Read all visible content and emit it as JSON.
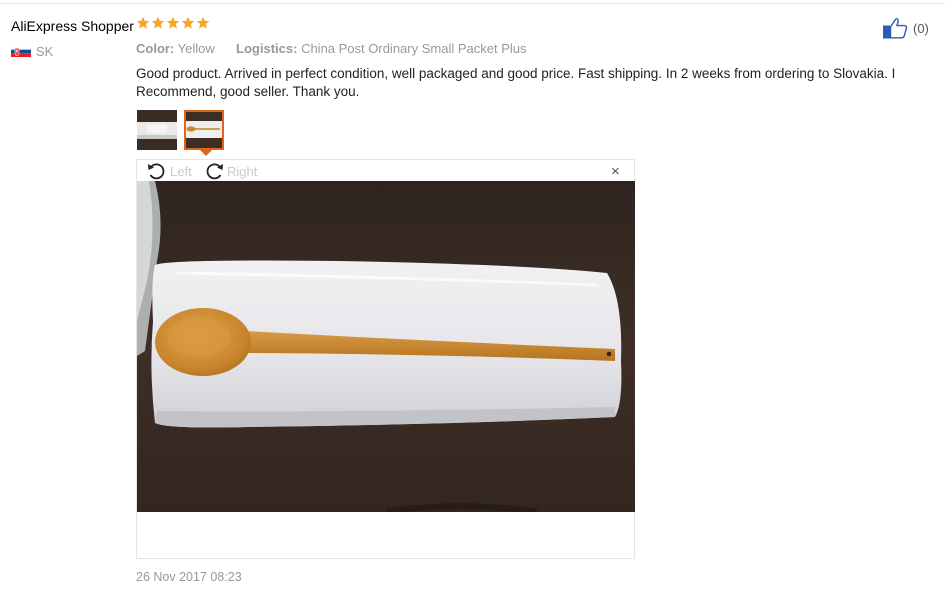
{
  "review": {
    "author": "AliExpress Shopper",
    "rating": 5,
    "country": "SK",
    "color_label": "Color:",
    "color_value": "Yellow",
    "logistics_label": "Logistics:",
    "logistics_value": "China Post Ordinary Small Packet Plus",
    "text": "Good product. Arrived in perfect condition, well packaged and good price. Fast shipping. In 2 weeks from ordering to Slovakia. I Recommend, good seller. Thank you.",
    "helpful_count": "(0)",
    "date": "26 Nov 2017 08:23"
  },
  "viewer": {
    "rotate_left": "Left",
    "rotate_right": "Right",
    "close": "×",
    "selected_thumbnail": 2
  },
  "colors": {
    "star": "#f5a623",
    "selected_outline": "#e0651c",
    "muted_text": "#999999"
  },
  "icons": {
    "star": "star-icon",
    "flag": "slovakia-flag-icon",
    "like": "thumbs-up-icon",
    "rotate_left": "rotate-left-icon",
    "rotate_right": "rotate-right-icon",
    "close": "close-icon"
  }
}
